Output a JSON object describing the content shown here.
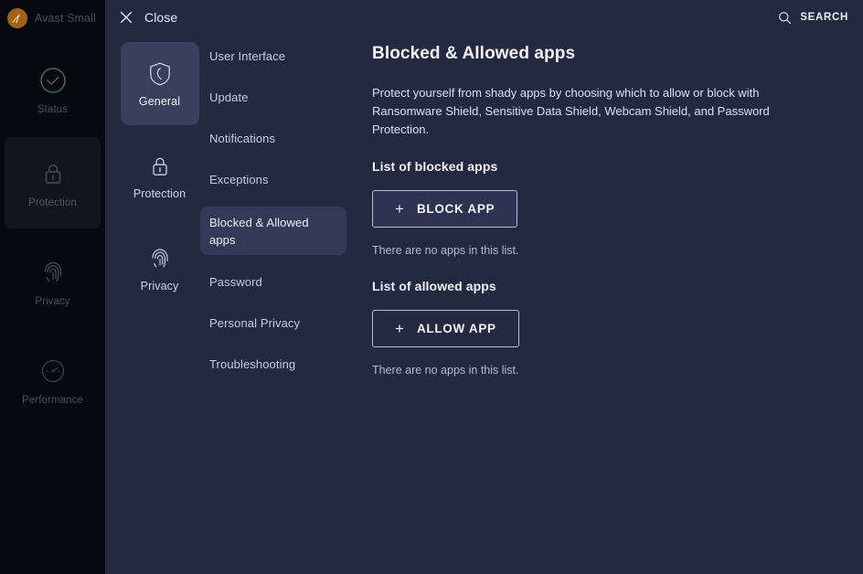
{
  "brand": {
    "name": "Avast Small",
    "logo_icon": "avast-logo-icon",
    "logo_color": "#a2620f"
  },
  "rail": {
    "items": [
      {
        "label": "Status",
        "icon": "check-circle-icon",
        "active": false
      },
      {
        "label": "Protection",
        "icon": "lock-icon",
        "active": true
      },
      {
        "label": "Privacy",
        "icon": "fingerprint-icon",
        "active": false
      },
      {
        "label": "Performance",
        "icon": "gauge-icon",
        "active": false
      }
    ]
  },
  "topbar": {
    "close_label": "Close",
    "close_icon": "close-x-icon",
    "search_label": "SEARCH",
    "search_icon": "search-icon"
  },
  "settings_categories": [
    {
      "label": "General",
      "icon": "shield-icon",
      "active": true
    },
    {
      "label": "Protection",
      "icon": "lock-icon",
      "active": false
    },
    {
      "label": "Privacy",
      "icon": "fingerprint-icon",
      "active": false
    }
  ],
  "submenu": [
    {
      "label": "User Interface",
      "active": false
    },
    {
      "label": "Update",
      "active": false
    },
    {
      "label": "Notifications",
      "active": false
    },
    {
      "label": "Exceptions",
      "active": false
    },
    {
      "label": "Blocked & Allowed apps",
      "active": true
    },
    {
      "label": "Password",
      "active": false
    },
    {
      "label": "Personal Privacy",
      "active": false
    },
    {
      "label": "Troubleshooting",
      "active": false
    }
  ],
  "content": {
    "title": "Blocked & Allowed apps",
    "description": "Protect yourself from shady apps by choosing which to allow or block with Ransomware Shield, Sensitive Data Shield, Webcam Shield, and Password Protection.",
    "blocked": {
      "heading": "List of blocked apps",
      "button_label": "BLOCK APP",
      "button_plus": "+",
      "empty_text": "There are no apps in this list."
    },
    "allowed": {
      "heading": "List of allowed apps",
      "button_label": "ALLOW APP",
      "button_plus": "+",
      "empty_text": "There are no apps in this list."
    }
  },
  "colors": {
    "rail_bg": "#07090f",
    "panel_bg": "#232941",
    "active_tile": "#39405c",
    "active_pill": "#333a55",
    "status_green": "#2e7d4f"
  }
}
